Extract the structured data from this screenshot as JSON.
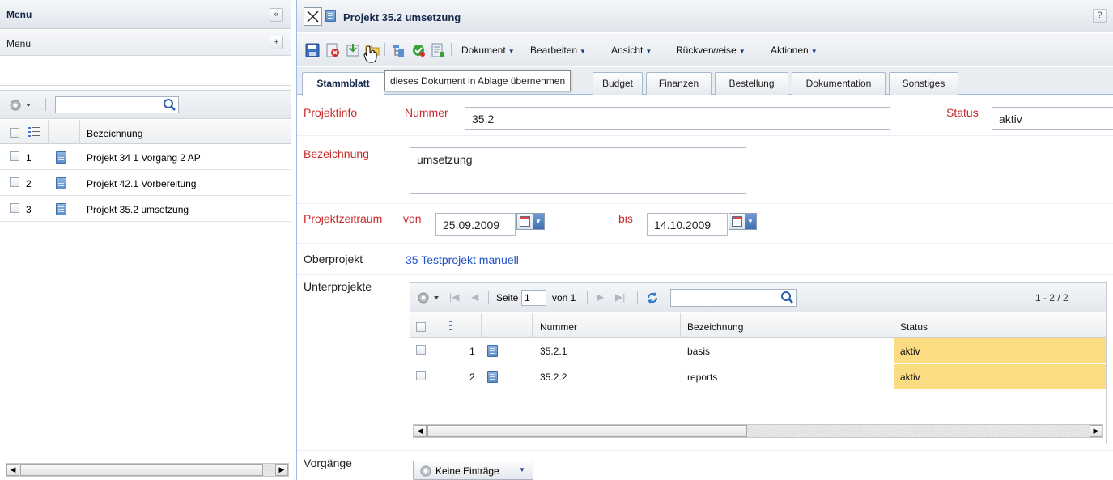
{
  "left": {
    "title": "Menu",
    "collapse_glyph": "«",
    "sub_title": "Menu",
    "add_glyph": "+",
    "search_placeholder": "",
    "grid_header": "Bezeichnung",
    "rows": [
      {
        "num": "1",
        "label": "Projekt 34 1 Vorgang 2 AP"
      },
      {
        "num": "2",
        "label": "Projekt 42.1 Vorbereitung"
      },
      {
        "num": "3",
        "label": "Projekt 35.2 umsetzung"
      }
    ]
  },
  "right": {
    "title": "Projekt 35.2 umsetzung",
    "help_glyph": "?",
    "menus": [
      "Dokument",
      "Bearbeiten",
      "Ansicht",
      "Rückverweise",
      "Aktionen"
    ],
    "tabs": [
      "Stammblatt",
      "Budget",
      "Finanzen",
      "Bestellung",
      "Dokumentation",
      "Sonstiges"
    ],
    "tooltip": "dieses Dokument in Ablage übernehmen",
    "form": {
      "projektinfo_label": "Projektinfo",
      "nummer_label": "Nummer",
      "nummer_value": "35.2",
      "status_label": "Status",
      "status_value": "aktiv",
      "bezeichnung_label": "Bezeichnung",
      "bezeichnung_value": "umsetzung",
      "zeitraum_label": "Projektzeitraum",
      "von_label": "von",
      "von_value": "25.09.2009",
      "bis_label": "bis",
      "bis_value": "14.10.2009",
      "oberprojekt_label": "Oberprojekt",
      "oberprojekt_link": "35 Testprojekt manuell",
      "unterprojekte_label": "Unterprojekte",
      "vorgaenge_label": "Vorgänge",
      "vorgaenge_button": "Keine Einträge"
    },
    "subgrid": {
      "page_label": "Seite",
      "page_value": "1",
      "page_of": "von 1",
      "range": "1 - 2 / 2",
      "columns": [
        "Nummer",
        "Bezeichnung",
        "Status"
      ],
      "rows": [
        {
          "num": "1",
          "nummer": "35.2.1",
          "bezeichnung": "basis",
          "status": "aktiv"
        },
        {
          "num": "2",
          "nummer": "35.2.2",
          "bezeichnung": "reports",
          "status": "aktiv"
        }
      ]
    }
  },
  "colors": {
    "label_red": "#c82b2b",
    "link_blue": "#1f50c8",
    "status_highlight": "#fcdc82",
    "panel_border": "#99bbe8"
  }
}
